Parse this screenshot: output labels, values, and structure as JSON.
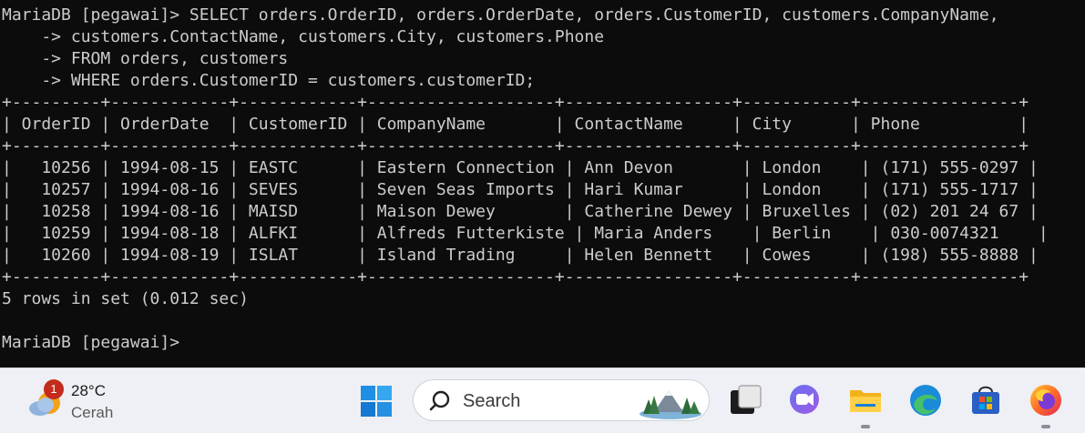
{
  "terminal": {
    "lines": [
      "MariaDB [pegawai]> SELECT orders.OrderID, orders.OrderDate, orders.CustomerID, customers.CompanyName,",
      "    -> customers.ContactName, customers.City, customers.Phone",
      "    -> FROM orders, customers",
      "    -> WHERE orders.CustomerID = customers.customerID;",
      "+---------+------------+------------+-------------------+-----------------+-----------+----------------+",
      "| OrderID | OrderDate  | CustomerID | CompanyName       | ContactName     | City      | Phone          |",
      "+---------+------------+------------+-------------------+-----------------+-----------+----------------+",
      "|   10256 | 1994-08-15 | EASTC      | Eastern Connection | Ann Devon       | London    | (171) 555-0297 |",
      "|   10257 | 1994-08-16 | SEVES      | Seven Seas Imports | Hari Kumar      | London    | (171) 555-1717 |",
      "|   10258 | 1994-08-16 | MAISD      | Maison Dewey       | Catherine Dewey | Bruxelles | (02) 201 24 67 |",
      "|   10259 | 1994-08-18 | ALFKI      | Alfreds Futterkiste | Maria Anders    | Berlin    | 030-0074321    |",
      "|   10260 | 1994-08-19 | ISLAT      | Island Trading     | Helen Bennett   | Cowes     | (198) 555-8888 |",
      "+---------+------------+------------+-------------------+-----------------+-----------+----------------+",
      "5 rows in set (0.012 sec)",
      "",
      "MariaDB [pegawai]>"
    ]
  },
  "taskbar": {
    "weather": {
      "badge": "1",
      "temp": "28°C",
      "condition": "Cerah"
    },
    "search": {
      "placeholder": "Search"
    },
    "apps": [
      "start-icon",
      "task-view-icon",
      "chat-icon",
      "file-explorer-icon",
      "edge-icon",
      "store-icon",
      "firefox-icon"
    ]
  },
  "colors": {
    "terminal_bg": "#0c0c0c",
    "terminal_fg": "#cccccc",
    "taskbar_bg": "#eef0f5"
  }
}
